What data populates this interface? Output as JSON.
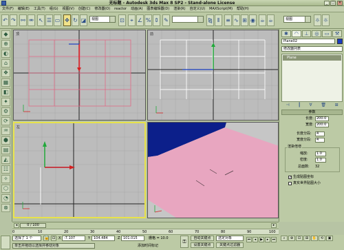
{
  "window": {
    "title": "无标题 - Autodesk 3ds Max 8 SP2 - Stand-alone License",
    "minimize": "_",
    "maximize": "□",
    "close": "×"
  },
  "menu": [
    "文件(F)",
    "编辑(E)",
    "工具(T)",
    "组(G)",
    "视图(V)",
    "创建(C)",
    "修改器(O)",
    "reactor",
    "动画(A)",
    "图表编辑器(D)",
    "渲染(R)",
    "自定义(U)",
    "MAXScript(M)",
    "帮助(H)"
  ],
  "toolbar": {
    "view_combo": "视图",
    "selection_set_combo": "",
    "named_set_combo": "视图"
  },
  "viewports": {
    "top_label": "顶",
    "front_label": "前",
    "left_label": "左",
    "persp_label": "透视"
  },
  "command_panel": {
    "object_name": "Plane02",
    "modifier_list": "修改器列表",
    "stack_item": "Plane",
    "parameters_rollout": "参数",
    "length_label": "长度:",
    "length_value": "200.0",
    "width_label": "宽度:",
    "width_value": "200.0",
    "length_segs_label": "长度分段:",
    "length_segs_value": "4",
    "width_segs_label": "宽度分段:",
    "width_segs_value": "4",
    "render_mult_label": "渲染倍增",
    "scale_label": "缩放:",
    "scale_value": "1.0",
    "density_label": "密度:",
    "density_value": "1.0",
    "total_faces_label": "总面数:",
    "total_faces_value": "32",
    "gen_uv_label": "生成贴图坐标",
    "real_world_label": "真实世界贴图大小"
  },
  "timeline": {
    "slider_text": "0 / 100",
    "ticks": [
      "0",
      "10",
      "20",
      "30",
      "40",
      "50",
      "60",
      "70",
      "80",
      "90",
      "100"
    ]
  },
  "status": {
    "selected_text": "选择了 1 个",
    "x_label": "X",
    "x_value": "-7.107",
    "y_label": "Y",
    "y_value": "104.484",
    "z_label": "Z",
    "z_value": "101.015",
    "grid_text": "栅格 = 10.0",
    "autokey": "自动关键点",
    "setkey": "设置关键点",
    "selected_obj": "选定对象",
    "key_filter": "关键点过滤器",
    "prompt": "单击并拖动以选择并移动对象",
    "add_tag": "添加时间标记"
  },
  "colors": {
    "selection_yellow": "#e8e24a",
    "plane_pink": "#e8a6c0",
    "persp_blue": "#0c1f8a"
  }
}
